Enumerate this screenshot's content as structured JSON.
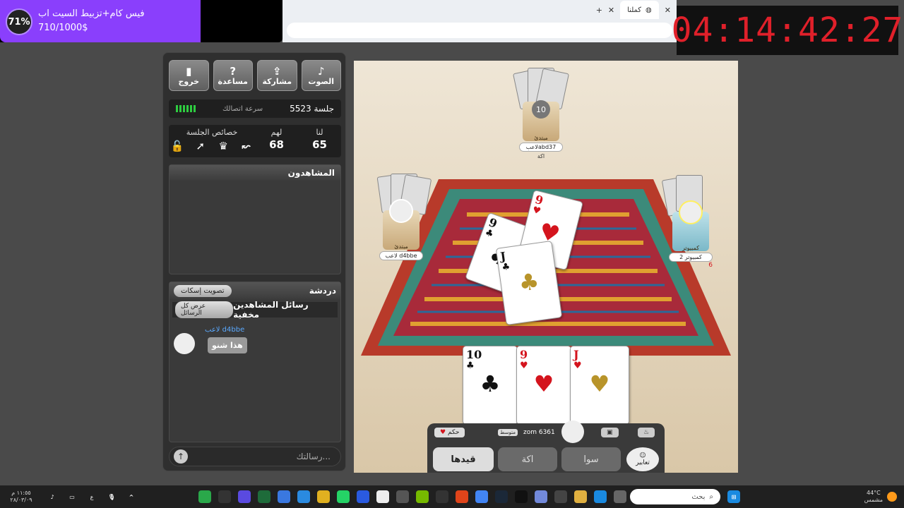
{
  "promo": {
    "percent": "71%",
    "title": "فيس كام+تزبيط السيت اب",
    "amount": "710/1000$"
  },
  "browser": {
    "tab_title": "كملنا"
  },
  "timer": "04:14:42:27",
  "panel": {
    "buttons": {
      "exit": "خروج",
      "help": "مساعدة",
      "share": "مشاركة",
      "sound": "الصوت"
    },
    "session": "جلسة 5523",
    "speed_label": "سرعة اتصالك",
    "stats": {
      "session_props": "خصائص الجلسة",
      "them_label": "لهم",
      "us_label": "لنا",
      "them": "68",
      "us": "65"
    },
    "viewers_title": "المشاهدون",
    "chat": {
      "title": "دردشة",
      "mute_vote": "تصويت إسكات",
      "hidden_note": "رسائل المشاهدين مخفية",
      "show_all": "عرض كل الرسائل",
      "sender": "لاعب d4bbe",
      "message": "هذا شنو",
      "placeholder": "رسالتك..."
    }
  },
  "game": {
    "top_player": {
      "level": "مبتدئ",
      "name": "لاعبabd37",
      "badge": "10",
      "status": "اكة"
    },
    "left_player": {
      "level": "مبتدئ",
      "name": "لاعب d4bbe"
    },
    "right_player": {
      "level": "كمبيوتر",
      "name": "كمبيوتر 2",
      "count": "6"
    },
    "table_cards": [
      {
        "rank": "9",
        "suit": "♣",
        "color": "blk"
      },
      {
        "rank": "9",
        "suit": "♥",
        "color": "red"
      },
      {
        "rank": "J",
        "suit": "♣",
        "color": "blk"
      }
    ],
    "hand": [
      {
        "rank": "10",
        "suit": "♣",
        "color": "blk"
      },
      {
        "rank": "9",
        "suit": "♥",
        "color": "red"
      },
      {
        "rank": "J",
        "suit": "♥",
        "color": "red"
      }
    ],
    "bottom": {
      "hakam": "حكم",
      "level_badge": "متوسط",
      "self_name": "zom 6361",
      "btn_qaydha": "قيدها",
      "btn_akka": "اكة",
      "btn_sawa": "سوا",
      "btn_emotes": "تعابير"
    }
  },
  "taskbar": {
    "search_placeholder": "بحث",
    "weather_temp": "44°C",
    "weather_desc": "مشمس",
    "time": "١١:٥٥ م",
    "date": "٢٨/٠٣/٠٩",
    "lang": "ع"
  }
}
